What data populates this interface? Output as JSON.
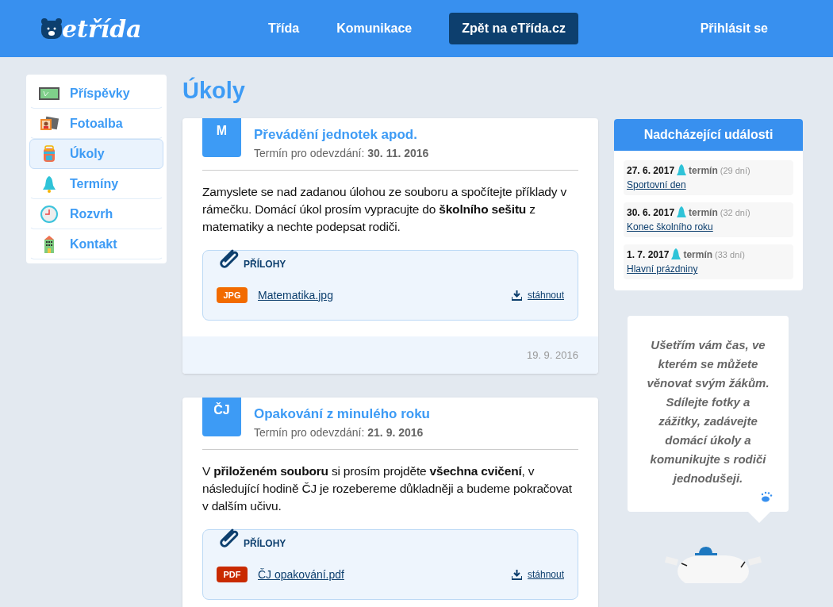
{
  "header": {
    "logo": "etřída",
    "nav": [
      {
        "label": "Třída",
        "kind": "link"
      },
      {
        "label": "Komunikace",
        "kind": "link"
      },
      {
        "label": "Zpět na eTřída.cz",
        "kind": "button"
      }
    ],
    "login": "Přihlásit se"
  },
  "sidebar": {
    "items": [
      {
        "label": "Příspěvky",
        "kind": "board",
        "selected": false
      },
      {
        "label": "Fotoalba",
        "kind": "photos",
        "selected": false
      },
      {
        "label": "Úkoly",
        "kind": "backpack",
        "selected": true
      },
      {
        "label": "Termíny",
        "kind": "bell",
        "selected": false
      },
      {
        "label": "Rozvrh",
        "kind": "clock",
        "selected": false
      },
      {
        "label": "Kontakt",
        "kind": "building",
        "selected": false
      }
    ]
  },
  "page_title": "Úkoly",
  "tasks": [
    {
      "subject": "M",
      "title": "Převádění jednotek apod.",
      "deadline_label": "Termín pro odevzdání:",
      "deadline": "30. 11. 2016",
      "text": "Zamyslete se nad zadanou úlohou ze souboru a spočítejte příklady v rámečku. Domácí úkol prosím vypracujte do **školního sešitu** z matematiky a nechte podepsat rodiči.",
      "attachments_title": "PŘÍLOHY",
      "attachments": [
        {
          "type": "JPG",
          "color": "#f26b00",
          "name": "Matematika.jpg",
          "download": "stáhnout"
        }
      ],
      "posted": "19. 9. 2016"
    },
    {
      "subject": "ČJ",
      "title": "Opakování z minulého roku",
      "deadline_label": "Termín pro odevzdání:",
      "deadline": "21. 9. 2016",
      "text": "V **přiloženém souboru** si prosím projděte **všechna cvičení**, v následující hodině ČJ je rozebereme důkladněji a budeme pokračovat v dalším učivu.",
      "attachments_title": "PŘÍLOHY",
      "attachments": [
        {
          "type": "PDF",
          "color": "#c92a00",
          "name": "ČJ opakování.pdf",
          "download": "stáhnout"
        }
      ]
    }
  ],
  "events": {
    "title": "Nadcházející události",
    "items": [
      {
        "date": "27. 6. 2017",
        "type": "termín",
        "days": "(29 dní)",
        "name": "Sportovní den"
      },
      {
        "date": "30. 6. 2017",
        "type": "termín",
        "days": "(32 dní)",
        "name": "Konec školního roku"
      },
      {
        "date": "1. 7. 2017",
        "type": "termín",
        "days": "(33 dní)",
        "name": "Hlavní prázdniny"
      }
    ]
  },
  "promo": {
    "text": "Ušetřím vám čas, ve kterém se můžete věnovat svým žákům. Sdílejte fotky a zážitky, zadávejte domácí úkoly a komunikujte s rodiči jednodušeji."
  }
}
